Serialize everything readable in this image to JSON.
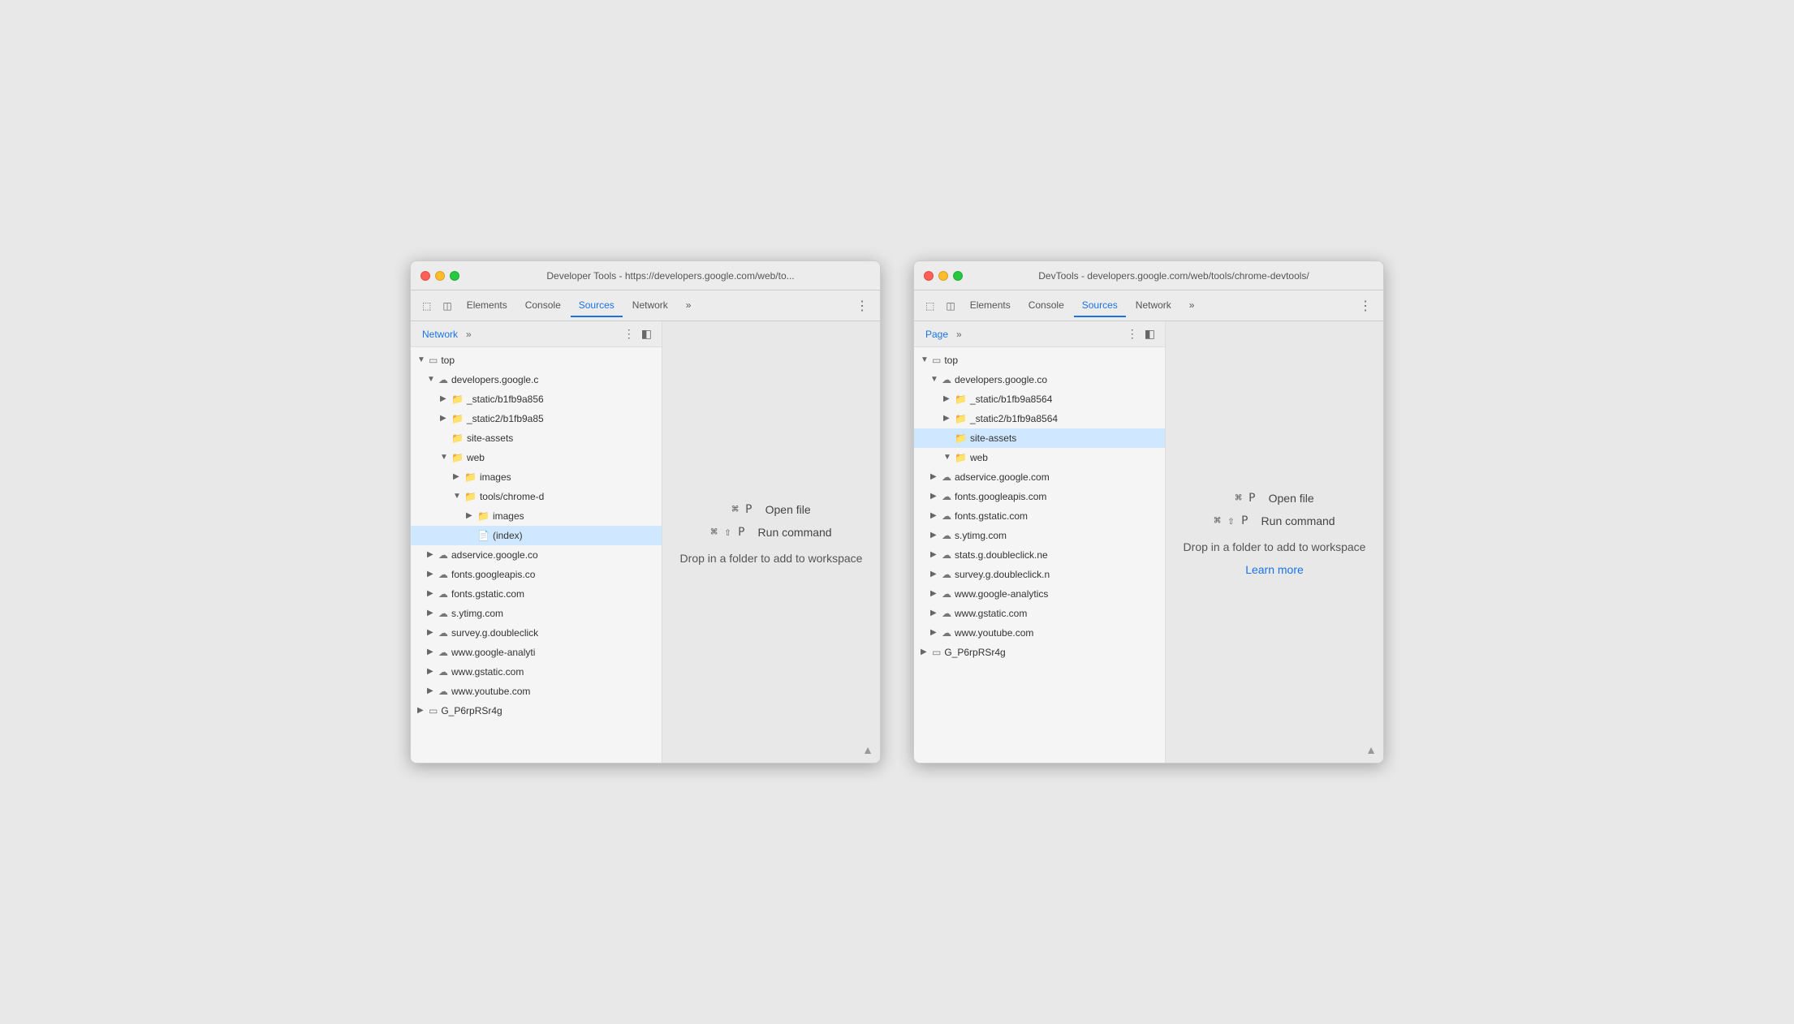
{
  "windows": [
    {
      "id": "window-left",
      "title": "Developer Tools - https://developers.google.com/web/to...",
      "tabs": [
        "Elements",
        "Console",
        "Sources",
        "Network",
        "»"
      ],
      "active_tab": "Sources",
      "panel_tab": "Network",
      "panel_has_more": true,
      "tree": [
        {
          "label": "top",
          "indent": 0,
          "arrow": "▼",
          "icon": "square"
        },
        {
          "label": "developers.google.c",
          "indent": 1,
          "arrow": "▼",
          "icon": "cloud"
        },
        {
          "label": "_static/b1fb9a856",
          "indent": 2,
          "arrow": "▶",
          "icon": "folder"
        },
        {
          "label": "_static2/b1fb9a85",
          "indent": 2,
          "arrow": "▶",
          "icon": "folder"
        },
        {
          "label": "site-assets",
          "indent": 2,
          "arrow": "",
          "icon": "folder"
        },
        {
          "label": "web",
          "indent": 2,
          "arrow": "▼",
          "icon": "folder"
        },
        {
          "label": "images",
          "indent": 3,
          "arrow": "▶",
          "icon": "folder"
        },
        {
          "label": "tools/chrome-d",
          "indent": 3,
          "arrow": "▼",
          "icon": "folder"
        },
        {
          "label": "images",
          "indent": 4,
          "arrow": "▶",
          "icon": "folder"
        },
        {
          "label": "(index)",
          "indent": 4,
          "arrow": "",
          "icon": "file",
          "selected": true
        },
        {
          "label": "adservice.google.co",
          "indent": 1,
          "arrow": "▶",
          "icon": "cloud"
        },
        {
          "label": "fonts.googleapis.co",
          "indent": 1,
          "arrow": "▶",
          "icon": "cloud"
        },
        {
          "label": "fonts.gstatic.com",
          "indent": 1,
          "arrow": "▶",
          "icon": "cloud"
        },
        {
          "label": "s.ytimg.com",
          "indent": 1,
          "arrow": "▶",
          "icon": "cloud"
        },
        {
          "label": "survey.g.doubleclick",
          "indent": 1,
          "arrow": "▶",
          "icon": "cloud"
        },
        {
          "label": "www.google-analyti",
          "indent": 1,
          "arrow": "▶",
          "icon": "cloud"
        },
        {
          "label": "www.gstatic.com",
          "indent": 1,
          "arrow": "▶",
          "icon": "cloud"
        },
        {
          "label": "www.youtube.com",
          "indent": 1,
          "arrow": "▶",
          "icon": "cloud"
        },
        {
          "label": "G_P6rpRSr4g",
          "indent": 0,
          "arrow": "▶",
          "icon": "square"
        }
      ],
      "editor": {
        "open_file_cmd": "⌘ P",
        "open_file_label": "Open file",
        "run_cmd": "⌘ ⇧ P",
        "run_label": "Run command",
        "drop_label": "Drop in a folder to add to workspace",
        "learn_more": null
      }
    },
    {
      "id": "window-right",
      "title": "DevTools - developers.google.com/web/tools/chrome-devtools/",
      "tabs": [
        "Elements",
        "Console",
        "Sources",
        "Network",
        "»"
      ],
      "active_tab": "Sources",
      "panel_tab": "Page",
      "panel_has_more": true,
      "tree": [
        {
          "label": "top",
          "indent": 0,
          "arrow": "▼",
          "icon": "square"
        },
        {
          "label": "developers.google.co",
          "indent": 1,
          "arrow": "▼",
          "icon": "cloud"
        },
        {
          "label": "_static/b1fb9a8564",
          "indent": 2,
          "arrow": "▶",
          "icon": "folder"
        },
        {
          "label": "_static2/b1fb9a8564",
          "indent": 2,
          "arrow": "▶",
          "icon": "folder"
        },
        {
          "label": "site-assets",
          "indent": 2,
          "arrow": "",
          "icon": "folder",
          "selected": true
        },
        {
          "label": "web",
          "indent": 2,
          "arrow": "▼",
          "icon": "folder"
        },
        {
          "label": "adservice.google.com",
          "indent": 1,
          "arrow": "▶",
          "icon": "cloud"
        },
        {
          "label": "fonts.googleapis.com",
          "indent": 1,
          "arrow": "▶",
          "icon": "cloud"
        },
        {
          "label": "fonts.gstatic.com",
          "indent": 1,
          "arrow": "▶",
          "icon": "cloud"
        },
        {
          "label": "s.ytimg.com",
          "indent": 1,
          "arrow": "▶",
          "icon": "cloud"
        },
        {
          "label": "stats.g.doubleclick.ne",
          "indent": 1,
          "arrow": "▶",
          "icon": "cloud"
        },
        {
          "label": "survey.g.doubleclick.n",
          "indent": 1,
          "arrow": "▶",
          "icon": "cloud"
        },
        {
          "label": "www.google-analytics",
          "indent": 1,
          "arrow": "▶",
          "icon": "cloud"
        },
        {
          "label": "www.gstatic.com",
          "indent": 1,
          "arrow": "▶",
          "icon": "cloud"
        },
        {
          "label": "www.youtube.com",
          "indent": 1,
          "arrow": "▶",
          "icon": "cloud"
        },
        {
          "label": "G_P6rpRSr4g",
          "indent": 0,
          "arrow": "▶",
          "icon": "square"
        }
      ],
      "editor": {
        "open_file_cmd": "⌘ P",
        "open_file_label": "Open file",
        "run_cmd": "⌘ ⇧ P",
        "run_label": "Run command",
        "drop_label": "Drop in a folder to add to workspace",
        "learn_more": "Learn more"
      }
    }
  ],
  "icons": {
    "devtools": "⬚",
    "panel_collapse": "◫",
    "scroll_up": "▲"
  }
}
